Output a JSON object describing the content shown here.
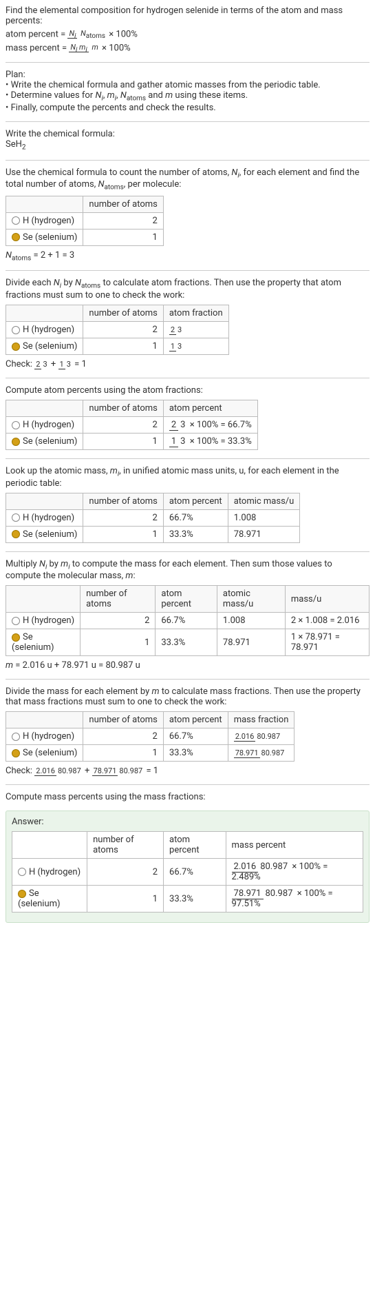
{
  "intro": {
    "title": "Find the elemental composition for hydrogen selenide in terms of the atom and mass percents:",
    "atom_percent_label": "atom percent = ",
    "atom_percent_frac_num": "N_i",
    "atom_percent_frac_den": "N_atoms",
    "times_100": " × 100%",
    "mass_percent_label": "mass percent = ",
    "mass_percent_frac_num": "N_i m_i",
    "mass_percent_frac_den": "m"
  },
  "plan": {
    "heading": "Plan:",
    "b1": "• Write the chemical formula and gather atomic masses from the periodic table.",
    "b2_pre": "• Determine values for ",
    "b2_vars": "N_i, m_i, N_atoms and m",
    "b2_post": " using these items.",
    "b3": "• Finally, compute the percents and check the results."
  },
  "formula_sec": {
    "heading": "Write the chemical formula:",
    "formula": "SeH",
    "formula_sub": "2"
  },
  "count_sec": {
    "text_pre": "Use the chemical formula to count the number of atoms, ",
    "ni": "N_i",
    "text_mid": ", for each element and find the total number of atoms, ",
    "natoms": "N_atoms",
    "text_post": ", per molecule:",
    "col_num": "number of atoms",
    "h_label": "H (hydrogen)",
    "h_count": "2",
    "se_label": "Se (selenium)",
    "se_count": "1",
    "natoms_eq": "N_atoms = 2 + 1 = 3"
  },
  "atom_frac_sec": {
    "text": "Divide each N_i by N_atoms to calculate atom fractions. Then use the property that atom fractions must sum to one to check the work:",
    "col_num": "number of atoms",
    "col_frac": "atom fraction",
    "h_label": "H (hydrogen)",
    "h_count": "2",
    "h_frac_num": "2",
    "h_frac_den": "3",
    "se_label": "Se (selenium)",
    "se_count": "1",
    "se_frac_num": "1",
    "se_frac_den": "3",
    "check_pre": "Check: ",
    "check_eq": " = 1"
  },
  "atom_pct_sec": {
    "text": "Compute atom percents using the atom fractions:",
    "col_num": "number of atoms",
    "col_pct": "atom percent",
    "h_label": "H (hydrogen)",
    "h_count": "2",
    "h_frac_num": "2",
    "h_frac_den": "3",
    "h_result": " × 100% = 66.7%",
    "se_label": "Se (selenium)",
    "se_count": "1",
    "se_frac_num": "1",
    "se_frac_den": "3",
    "se_result": " × 100% = 33.3%"
  },
  "mass_lookup_sec": {
    "text": "Look up the atomic mass, m_i, in unified atomic mass units, u, for each element in the periodic table:",
    "col_num": "number of atoms",
    "col_pct": "atom percent",
    "col_mass": "atomic mass/u",
    "h_label": "H (hydrogen)",
    "h_count": "2",
    "h_pct": "66.7%",
    "h_mass": "1.008",
    "se_label": "Se (selenium)",
    "se_count": "1",
    "se_pct": "33.3%",
    "se_mass": "78.971"
  },
  "mass_calc_sec": {
    "text": "Multiply N_i by m_i to compute the mass for each element. Then sum those values to compute the molecular mass, m:",
    "col_num": "number of atoms",
    "col_pct": "atom percent",
    "col_mass": "atomic mass/u",
    "col_massu": "mass/u",
    "h_label": "H (hydrogen)",
    "h_count": "2",
    "h_pct": "66.7%",
    "h_mass": "1.008",
    "h_calc": "2 × 1.008 = 2.016",
    "se_label": "Se (selenium)",
    "se_count": "1",
    "se_pct": "33.3%",
    "se_mass": "78.971",
    "se_calc": "1 × 78.971 = 78.971",
    "m_eq": "m = 2.016 u + 78.971 u = 80.987 u"
  },
  "mass_frac_sec": {
    "text": "Divide the mass for each element by m to calculate mass fractions. Then use the property that mass fractions must sum to one to check the work:",
    "col_num": "number of atoms",
    "col_pct": "atom percent",
    "col_mfrac": "mass fraction",
    "h_label": "H (hydrogen)",
    "h_count": "2",
    "h_pct": "66.7%",
    "h_num": "2.016",
    "h_den": "80.987",
    "se_label": "Se (selenium)",
    "se_count": "1",
    "se_pct": "33.3%",
    "se_num": "78.971",
    "se_den": "80.987",
    "check_pre": "Check: ",
    "check_eq": " = 1"
  },
  "mass_pct_sec": {
    "text": "Compute mass percents using the mass fractions:"
  },
  "answer": {
    "heading": "Answer:",
    "col_num": "number of atoms",
    "col_pct": "atom percent",
    "col_mpct": "mass percent",
    "h_label": "H (hydrogen)",
    "h_count": "2",
    "h_pct": "66.7%",
    "h_num": "2.016",
    "h_den": "80.987",
    "h_result": " × 100% = 2.489%",
    "se_label": "Se (selenium)",
    "se_count": "1",
    "se_pct": "33.3%",
    "se_num": "78.971",
    "se_den": "80.987",
    "se_result": " × 100% = 97.51%"
  }
}
